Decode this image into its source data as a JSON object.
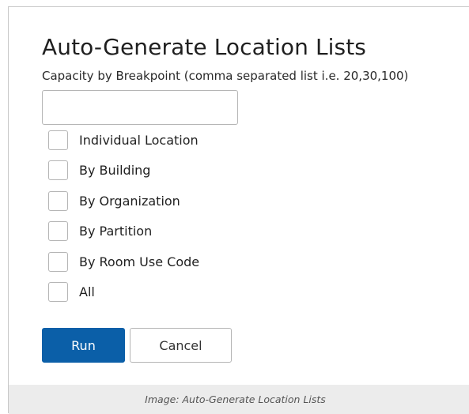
{
  "dialog": {
    "title": "Auto-Generate Location Lists",
    "subtitle": "Capacity by Breakpoint (comma separated list i.e. 20,30,100)",
    "capacity_input": {
      "value": "",
      "placeholder": ""
    },
    "options": [
      {
        "label": "Individual Location",
        "checked": false
      },
      {
        "label": "By Building",
        "checked": false
      },
      {
        "label": "By Organization",
        "checked": false
      },
      {
        "label": "By Partition",
        "checked": false
      },
      {
        "label": "By Room Use Code",
        "checked": false
      },
      {
        "label": "All",
        "checked": false
      }
    ],
    "run_label": "Run",
    "cancel_label": "Cancel"
  },
  "caption": "Image: Auto-Generate Location Lists",
  "colors": {
    "primary_button": "#0b5fa8",
    "caption_bar": "#ececec"
  }
}
